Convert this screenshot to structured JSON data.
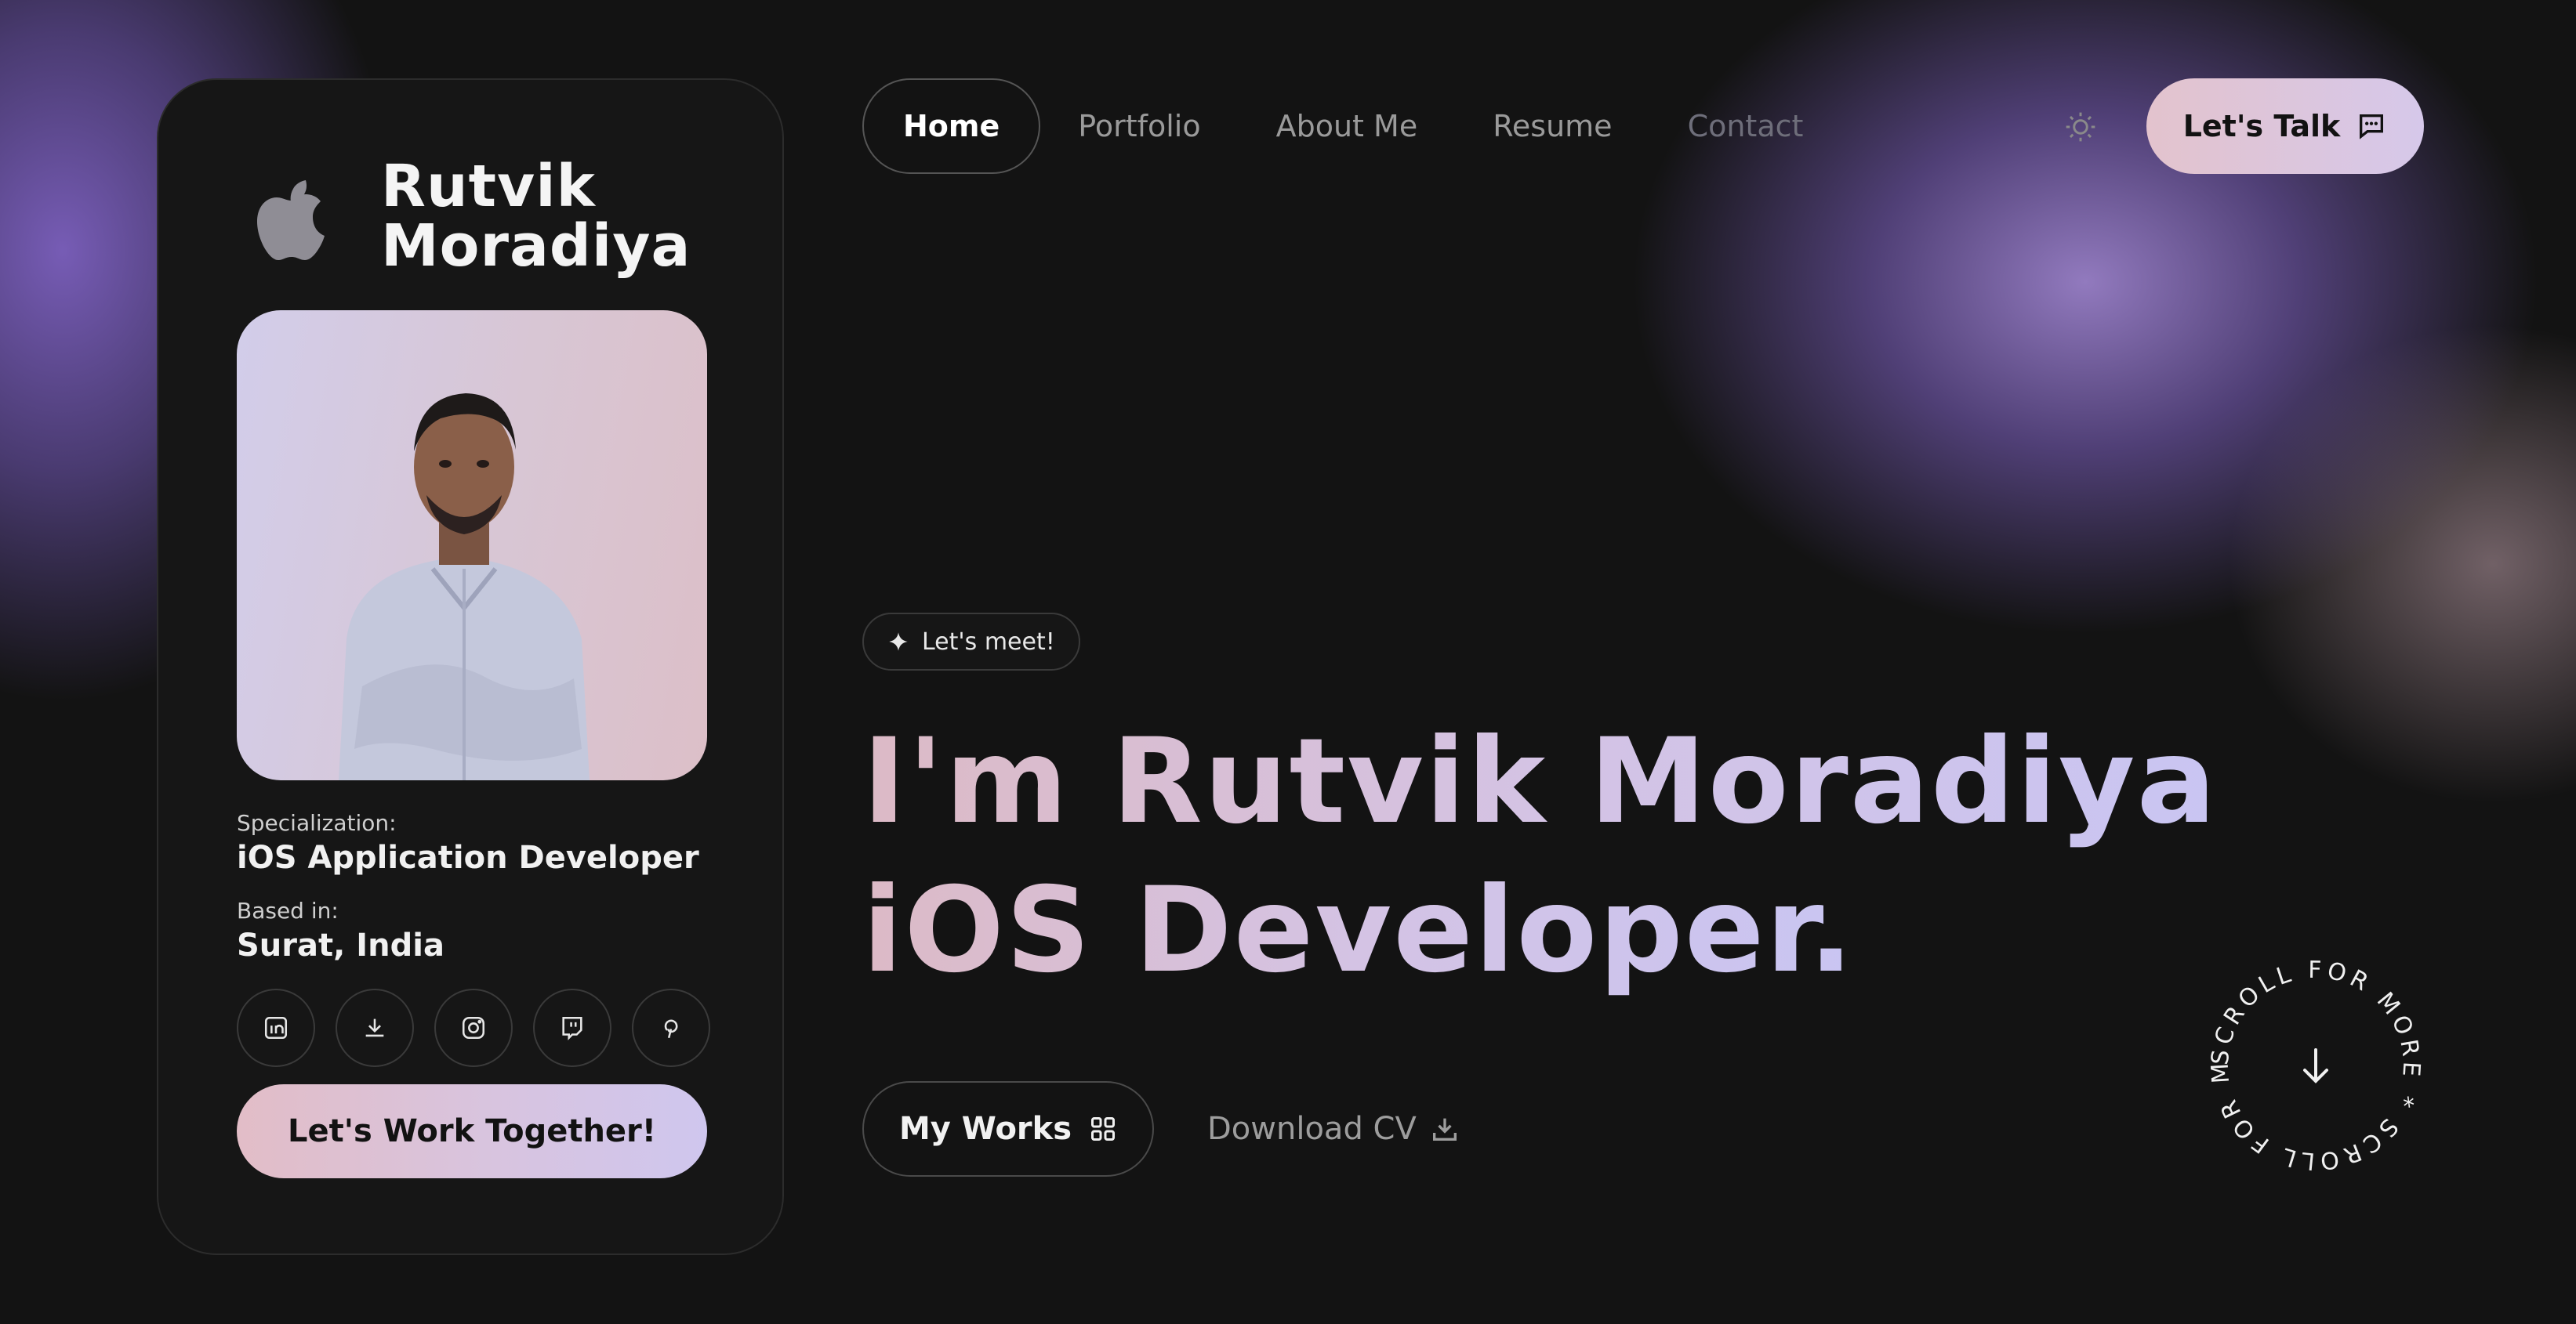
{
  "card": {
    "name": "Rutvik Moradiya",
    "logo_icon": "apple-logo-icon",
    "specialization_label": "Specialization:",
    "specialization_value": "iOS Application Developer",
    "based_label": "Based in:",
    "based_value": "Surat, India",
    "socials": [
      "linkedin-icon",
      "download-icon",
      "instagram-icon",
      "twitch-icon",
      "pinterest-icon"
    ],
    "cta_label": "Let's Work Together!"
  },
  "nav": {
    "items": [
      {
        "label": "Home",
        "active": true
      },
      {
        "label": "Portfolio",
        "active": false
      },
      {
        "label": "About Me",
        "active": false
      },
      {
        "label": "Resume",
        "active": false
      },
      {
        "label": "Contact",
        "active": false
      }
    ],
    "theme_icon": "sun-icon",
    "talk_label": "Let's Talk"
  },
  "hero": {
    "badge": "Let's meet!",
    "line1": "I'm Rutvik Moradiya",
    "line2": "iOS Developer.",
    "works_label": "My Works",
    "cv_label": "Download CV",
    "scroll_text": "SCROLL FOR MORE * SCROLL FOR MORE * "
  },
  "colors": {
    "background": "#131313",
    "accent_pink": "#e2bdc7",
    "accent_lavender": "#cfc6ee",
    "glow_purple": "#9a82d2"
  }
}
